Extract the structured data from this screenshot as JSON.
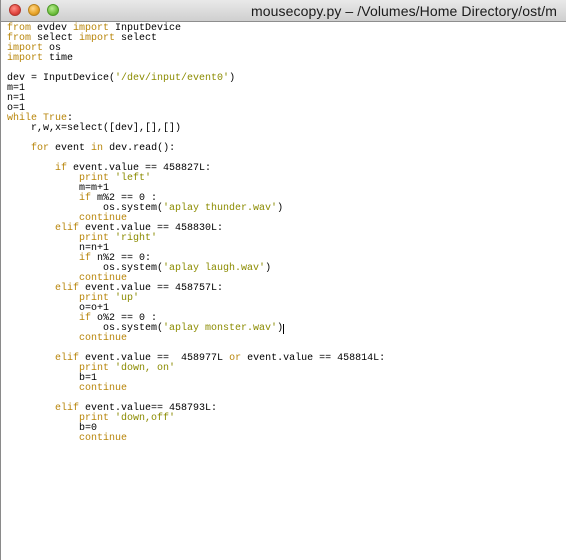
{
  "window": {
    "title": "mousecopy.py – /Volumes/Home Directory/ost/m"
  },
  "colors": {
    "keyword": "#b8860b",
    "string": "#8b8b00",
    "text": "#000000"
  },
  "code": {
    "lines": [
      [
        {
          "t": "from",
          "k": "kw"
        },
        {
          "t": " evdev "
        },
        {
          "t": "import",
          "k": "kw"
        },
        {
          "t": " InputDevice"
        }
      ],
      [
        {
          "t": "from",
          "k": "kw"
        },
        {
          "t": " select "
        },
        {
          "t": "import",
          "k": "kw"
        },
        {
          "t": " select"
        }
      ],
      [
        {
          "t": "import",
          "k": "kw"
        },
        {
          "t": " os"
        }
      ],
      [
        {
          "t": "import",
          "k": "kw"
        },
        {
          "t": " time"
        }
      ],
      [],
      [
        {
          "t": "dev = InputDevice("
        },
        {
          "t": "'/dev/input/event0'",
          "k": "str"
        },
        {
          "t": ")"
        }
      ],
      [
        {
          "t": "m=1"
        }
      ],
      [
        {
          "t": "n=1"
        }
      ],
      [
        {
          "t": "o=1"
        }
      ],
      [
        {
          "t": "while",
          "k": "kw"
        },
        {
          "t": " "
        },
        {
          "t": "True",
          "k": "kw"
        },
        {
          "t": ":"
        }
      ],
      [
        {
          "t": "    r,w,x=select([dev],[],[])"
        }
      ],
      [],
      [
        {
          "t": "    "
        },
        {
          "t": "for",
          "k": "kw"
        },
        {
          "t": " event "
        },
        {
          "t": "in",
          "k": "kw"
        },
        {
          "t": " dev.read():"
        }
      ],
      [],
      [
        {
          "t": "        "
        },
        {
          "t": "if",
          "k": "kw"
        },
        {
          "t": " event.value == 458827L:"
        }
      ],
      [
        {
          "t": "            "
        },
        {
          "t": "print",
          "k": "kw"
        },
        {
          "t": " "
        },
        {
          "t": "'left'",
          "k": "str"
        }
      ],
      [
        {
          "t": "            m=m+1"
        }
      ],
      [
        {
          "t": "            "
        },
        {
          "t": "if",
          "k": "kw"
        },
        {
          "t": " m%2 == 0 :"
        }
      ],
      [
        {
          "t": "                os.system("
        },
        {
          "t": "'aplay thunder.wav'",
          "k": "str"
        },
        {
          "t": ")"
        }
      ],
      [
        {
          "t": "            "
        },
        {
          "t": "continue",
          "k": "kw"
        }
      ],
      [
        {
          "t": "        "
        },
        {
          "t": "elif",
          "k": "kw"
        },
        {
          "t": " event.value == 458830L:"
        }
      ],
      [
        {
          "t": "            "
        },
        {
          "t": "print",
          "k": "kw"
        },
        {
          "t": " "
        },
        {
          "t": "'right'",
          "k": "str"
        }
      ],
      [
        {
          "t": "            n=n+1"
        }
      ],
      [
        {
          "t": "            "
        },
        {
          "t": "if",
          "k": "kw"
        },
        {
          "t": " n%2 == 0:"
        }
      ],
      [
        {
          "t": "                os.system("
        },
        {
          "t": "'aplay laugh.wav'",
          "k": "str"
        },
        {
          "t": ")"
        }
      ],
      [
        {
          "t": "            "
        },
        {
          "t": "continue",
          "k": "kw"
        }
      ],
      [
        {
          "t": "        "
        },
        {
          "t": "elif",
          "k": "kw"
        },
        {
          "t": " event.value == 458757L:"
        }
      ],
      [
        {
          "t": "            "
        },
        {
          "t": "print",
          "k": "kw"
        },
        {
          "t": " "
        },
        {
          "t": "'up'",
          "k": "str"
        }
      ],
      [
        {
          "t": "            o=o+1"
        }
      ],
      [
        {
          "t": "            "
        },
        {
          "t": "if",
          "k": "kw"
        },
        {
          "t": " o%2 == 0 :"
        }
      ],
      [
        {
          "t": "                os.system("
        },
        {
          "t": "'aplay monster.wav'",
          "k": "str"
        },
        {
          "t": ")"
        },
        {
          "t": "",
          "k": "cursor"
        }
      ],
      [
        {
          "t": "            "
        },
        {
          "t": "continue",
          "k": "kw"
        }
      ],
      [],
      [
        {
          "t": "        "
        },
        {
          "t": "elif",
          "k": "kw"
        },
        {
          "t": " event.value ==  458977L "
        },
        {
          "t": "or",
          "k": "kw"
        },
        {
          "t": " event.value == 458814L:"
        }
      ],
      [
        {
          "t": "            "
        },
        {
          "t": "print",
          "k": "kw"
        },
        {
          "t": " "
        },
        {
          "t": "'down, on'",
          "k": "str"
        }
      ],
      [
        {
          "t": "            b=1"
        }
      ],
      [
        {
          "t": "            "
        },
        {
          "t": "continue",
          "k": "kw"
        }
      ],
      [],
      [
        {
          "t": "        "
        },
        {
          "t": "elif",
          "k": "kw"
        },
        {
          "t": " event.value== 458793L:"
        }
      ],
      [
        {
          "t": "            "
        },
        {
          "t": "print",
          "k": "kw"
        },
        {
          "t": " "
        },
        {
          "t": "'down,off'",
          "k": "str"
        }
      ],
      [
        {
          "t": "            b=0"
        }
      ],
      [
        {
          "t": "            "
        },
        {
          "t": "continue",
          "k": "kw"
        }
      ]
    ]
  }
}
